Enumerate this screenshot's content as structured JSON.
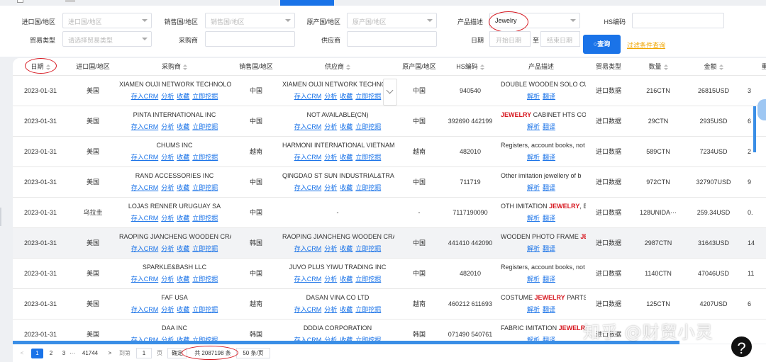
{
  "filters": {
    "import_country_label": "进口国/地区",
    "import_country_placeholder": "进口国/地区",
    "sales_country_label": "销售国/地区",
    "sales_country_placeholder": "销售国/地区",
    "origin_country_label": "原产国/地区",
    "origin_country_placeholder": "原产国/地区",
    "product_desc_label": "产品描述",
    "product_desc_value": "Jewelry",
    "hs_label": "HS编码",
    "trade_type_label": "贸易类型",
    "trade_type_placeholder": "请选择贸易类型",
    "buyer_label": "采购商",
    "supplier_label": "供应商",
    "date_label": "日期",
    "date_start_placeholder": "开始日期",
    "date_to": "至",
    "date_end_placeholder": "结束日期",
    "search_button": "查询",
    "filter_link": "过滤条件查询"
  },
  "table": {
    "headers": [
      "日期",
      "进口国/地区",
      "采购商",
      "销售国/地区",
      "供应商",
      "原产国/地区",
      "HS编码",
      "产品描述",
      "贸易类型",
      "数量",
      "金额",
      "重"
    ],
    "buyer_actions": [
      "存入CRM",
      "分析",
      "收藏",
      "立即挖掘"
    ],
    "desc_actions": [
      "解析",
      "翻译"
    ],
    "rows": [
      {
        "date": "2023-01-31",
        "imp": "美国",
        "buyer": "XIAMEN OUJI NETWORK TECHNOLOGY",
        "sale": "中国",
        "supplier": "XIAMEN OUJI NETWORK TECHNOLOGY",
        "origin": "中国",
        "hs": "940540",
        "desc_pre": "DOUBLE WOODEN SOLO CUP",
        "desc_kw": "",
        "desc_post": "",
        "trade": "进口数据",
        "qty": "216CTN",
        "amount": "26815USD",
        "weight": "3"
      },
      {
        "date": "2023-01-31",
        "imp": "美国",
        "buyer": "PINTA INTERNATIONAL INC",
        "sale": "中国",
        "supplier": "NOT AVAILABLE(CN)",
        "origin": "中国",
        "hs": "392690 442199",
        "desc_pre": "",
        "desc_kw": "JEWELRY",
        "desc_post": " CABINET HTS CODE",
        "trade": "进口数据",
        "qty": "29CTN",
        "amount": "2935USD",
        "weight": "6"
      },
      {
        "date": "2023-01-31",
        "imp": "美国",
        "buyer": "CHUMS INC",
        "sale": "越南",
        "supplier": "HARMONI INTERNATIONAL VIETNAM",
        "origin": "越南",
        "hs": "482010",
        "desc_pre": "Registers, account books, not",
        "desc_kw": "",
        "desc_post": "",
        "trade": "进口数据",
        "qty": "589CTN",
        "amount": "7234USD",
        "weight": "2"
      },
      {
        "date": "2023-01-31",
        "imp": "美国",
        "buyer": "RAND ACCESSORIES INC",
        "sale": "中国",
        "supplier": "QINGDAO ST SUN INDUSTRIAL&TRADE",
        "origin": "中国",
        "hs": "711719",
        "desc_pre": "Other imitation jewellery of b",
        "desc_kw": "",
        "desc_post": "",
        "trade": "进口数据",
        "qty": "972CTN",
        "amount": "327907USD",
        "weight": "9"
      },
      {
        "date": "2023-01-31",
        "imp": "乌拉圭",
        "buyer": "LOJAS RENNER URUGUAY SA",
        "sale": "中国",
        "supplier": "-",
        "origin": "-",
        "hs": "7117190090",
        "desc_pre": "OTH IMITATION ",
        "desc_kw": "JEWELRY",
        "desc_post": ", BA",
        "trade": "进口数据",
        "qty": "128UNIDA···",
        "amount": "259.34USD",
        "weight": "0."
      },
      {
        "date": "2023-01-31",
        "imp": "美国",
        "buyer": "RAOPING JIANCHENG WOODEN CRAFT",
        "sale": "韩国",
        "supplier": "RAOPING JIANCHENG WOODEN CRAFT",
        "origin": "中国",
        "hs": "441410 442090",
        "desc_pre": "WOODEN PHOTO FRAME ",
        "desc_kw": "JEW",
        "desc_post": "",
        "trade": "进口数据",
        "qty": "2987CTN",
        "amount": "31643USD",
        "weight": "14"
      },
      {
        "date": "2023-01-31",
        "imp": "美国",
        "buyer": "SPARKLE&BASH LLC",
        "sale": "中国",
        "supplier": "JUVO PLUS YIWU TRADING INC",
        "origin": "中国",
        "hs": "482010",
        "desc_pre": "Registers, account books, not",
        "desc_kw": "",
        "desc_post": "",
        "trade": "进口数据",
        "qty": "1140CTN",
        "amount": "47046USD",
        "weight": "11"
      },
      {
        "date": "2023-01-31",
        "imp": "美国",
        "buyer": "FAF USA",
        "sale": "越南",
        "supplier": "DASAN VINA CO LTD",
        "origin": "越南",
        "hs": "460212 611693",
        "desc_pre": "COSTUME ",
        "desc_kw": "JEWELRY",
        "desc_post": " PARTS O",
        "trade": "进口数据",
        "qty": "125CTN",
        "amount": "4207USD",
        "weight": "6"
      },
      {
        "date": "2023-01-31",
        "imp": "美国",
        "buyer": "DAA INC",
        "sale": "韩国",
        "supplier": "DDDIA CORPORATION",
        "origin": "韩国",
        "hs": "071490 540761",
        "desc_pre": "FABRIC IMITATION ",
        "desc_kw": "JEWELRY",
        "desc_post": "",
        "trade": "进口数据",
        "qty": "",
        "amount": "",
        "weight": ""
      }
    ]
  },
  "pager": {
    "prev": "<",
    "p1": "1",
    "p2": "2",
    "p3": "3",
    "ellipsis": "···",
    "last": "41744",
    "next": ">",
    "goto_label": "到第",
    "goto_value": "1",
    "page_unit": "页",
    "confirm": "确定",
    "total": "共 2087198 条",
    "page_size": "50 条/页"
  },
  "watermark": "知乎 @财贸小灵",
  "help_icon_text": "?",
  "colors": {
    "accent": "#1a73e8",
    "keyword": "#d71921",
    "link_orange": "#f0a500",
    "annotation_ring": "#d71921"
  }
}
